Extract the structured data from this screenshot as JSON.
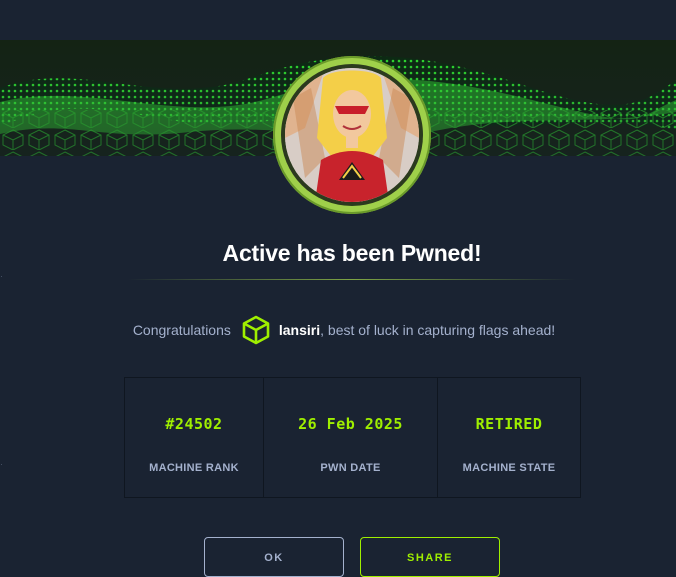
{
  "modal": {
    "title": "Active has been Pwned!",
    "congrats_prefix": "Congratulations",
    "username": "lansiri",
    "congrats_suffix": ", best of luck in capturing flags ahead!"
  },
  "stats": [
    {
      "value": "#24502",
      "label": "MACHINE RANK"
    },
    {
      "value": "26 Feb 2025",
      "label": "PWN DATE"
    },
    {
      "value": "RETIRED",
      "label": "MACHINE STATE"
    }
  ],
  "buttons": {
    "ok_label": "OK",
    "share_label": "SHARE"
  },
  "icons": {
    "user": "hexagon-cube-icon",
    "avatar": "machine-avatar-icon"
  },
  "colors": {
    "background": "#1a2332",
    "accent": "#9fef00",
    "muted_text": "#a4b1cd",
    "ring": "#9fd04a"
  }
}
